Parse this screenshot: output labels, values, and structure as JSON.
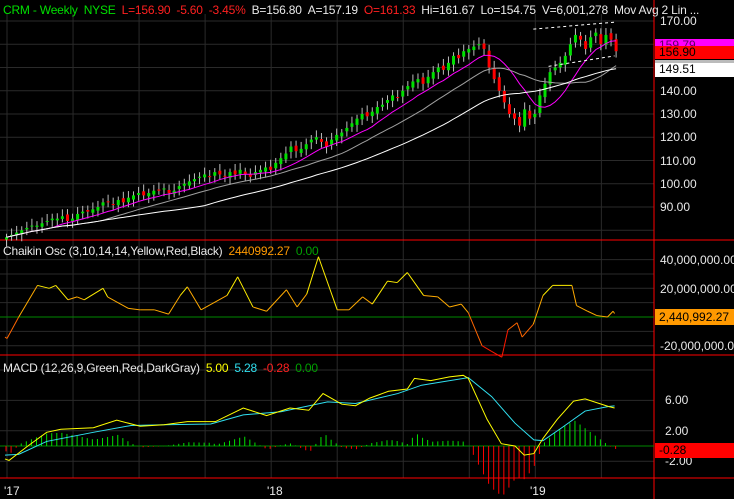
{
  "header": {
    "symbol": "CRM - Weekly",
    "exchange": "NYSE",
    "last": "L=156.90",
    "change": "-5.60",
    "change_pct": "-3.45%",
    "bid": "B=156.80",
    "ask": "A=157.19",
    "open": "O=161.33",
    "high": "Hi=161.67",
    "low": "Lo=154.75",
    "volume": "V=6,001,278",
    "study": "Mov Avg 2 Lin ..."
  },
  "price_axis": {
    "ticks": [
      "170.00",
      "140.00",
      "130.00",
      "120.00",
      "110.00",
      "100.00",
      "90.00"
    ],
    "tags": {
      "ma_short": "159.79",
      "last": "156.90",
      "ma_long": "149.51"
    }
  },
  "chaikin": {
    "title": "Chaikin Osc (3,10,14,14,Yellow,Red,Black)",
    "value": "2440992.27",
    "zero": "0.00",
    "ticks": [
      "40,000,000.00",
      "20,000,000.00",
      "-20,000,000.00"
    ],
    "tag": "2,440,992.27"
  },
  "macd": {
    "title": "MACD (12,26,9,Green,Red,DarkGray)",
    "macd_value": "5.00",
    "signal_value": "5.28",
    "hist_value": "-0.28",
    "zero": "0.00",
    "ticks": [
      "6.00",
      "2.00",
      "-2.00"
    ],
    "tag": "-0.28"
  },
  "date_axis": {
    "labels": [
      "'17",
      "'18",
      "'19"
    ]
  },
  "colors": {
    "up": "#00e000",
    "down": "#ff0000",
    "ma10": "#ff00ff",
    "ma20": "#a0a0a0",
    "ma40": "#ffffff",
    "axis": "#ff0000",
    "grid": "#2a2a2a"
  },
  "chart_data": [
    {
      "type": "candlestick",
      "title": "CRM - Weekly",
      "x_unit": "week index from Jan 2017",
      "ylim": [
        76,
        175
      ],
      "closes": [
        77,
        78,
        79,
        80,
        81,
        82,
        82,
        83,
        84,
        85,
        85,
        86,
        84,
        85,
        87,
        88,
        88,
        89,
        90,
        92,
        92,
        91,
        93,
        92,
        94,
        95,
        96,
        95,
        96,
        97,
        97,
        98,
        96,
        97,
        99,
        100,
        101,
        102,
        103,
        104,
        103,
        105,
        104,
        103,
        105,
        104,
        106,
        104,
        103,
        105,
        106,
        107,
        106,
        109,
        111,
        113,
        116,
        114,
        115,
        117,
        119,
        120,
        118,
        116,
        119,
        121,
        122,
        124,
        126,
        128,
        130,
        129,
        131,
        133,
        134,
        136,
        138,
        137,
        140,
        142,
        144,
        145,
        143,
        146,
        148,
        150,
        149,
        152,
        155,
        154,
        157,
        158,
        159,
        160,
        158,
        150,
        145,
        140,
        135,
        130,
        128,
        125,
        132,
        128,
        130,
        138,
        143,
        148,
        150,
        152,
        155,
        160,
        164,
        162,
        158,
        163,
        165,
        160,
        164,
        162,
        157
      ],
      "moving_averages": [
        {
          "period": 10,
          "color": "#ff00ff"
        },
        {
          "period": 20,
          "color": "#a0a0a0"
        },
        {
          "period": 40,
          "color": "#ffffff"
        }
      ],
      "trendlines": [
        [
          [
            104,
            166.5
          ],
          [
            120,
            169.5
          ]
        ],
        [
          [
            107,
            150.5
          ],
          [
            120,
            155
          ]
        ]
      ]
    },
    {
      "type": "line",
      "title": "Chaikin Osc",
      "unit": "millions",
      "ylim": [
        -30,
        50
      ],
      "points": [
        [
          0,
          -14
        ],
        [
          0.4,
          -15
        ],
        [
          2.7,
          0
        ],
        [
          6.4,
          22
        ],
        [
          8.7,
          20
        ],
        [
          10,
          22
        ],
        [
          12.4,
          12
        ],
        [
          14.2,
          14
        ],
        [
          15.6,
          12
        ],
        [
          19.3,
          20
        ],
        [
          20.2,
          14
        ],
        [
          24.3,
          6
        ],
        [
          26.6,
          5
        ],
        [
          29.4,
          5
        ],
        [
          32.2,
          2
        ],
        [
          34.5,
          15
        ],
        [
          35.9,
          21
        ],
        [
          38.6,
          5
        ],
        [
          43.7,
          15
        ],
        [
          45.8,
          28
        ],
        [
          48.8,
          7
        ],
        [
          51.5,
          4
        ],
        [
          55.4,
          19
        ],
        [
          57.5,
          7
        ],
        [
          59.4,
          16
        ],
        [
          61.7,
          42
        ],
        [
          65.4,
          5
        ],
        [
          67.7,
          5
        ],
        [
          70.4,
          14
        ],
        [
          72.3,
          9
        ],
        [
          75.3,
          25
        ],
        [
          77.2,
          24
        ],
        [
          79.2,
          31
        ],
        [
          82.4,
          15
        ],
        [
          85.2,
          14
        ],
        [
          87.5,
          7
        ],
        [
          89.8,
          9
        ],
        [
          91.2,
          3
        ],
        [
          93.9,
          -20
        ],
        [
          95.8,
          -24
        ],
        [
          97.8,
          -28
        ],
        [
          99,
          -9
        ],
        [
          100.8,
          -4
        ],
        [
          101.8,
          -14
        ],
        [
          104,
          -5
        ],
        [
          105.9,
          15
        ],
        [
          107.8,
          22
        ],
        [
          111.6,
          22
        ],
        [
          112.5,
          8
        ],
        [
          114.7,
          4
        ],
        [
          116.5,
          1
        ],
        [
          118.6,
          0
        ],
        [
          119.7,
          4
        ],
        [
          120,
          2.44
        ]
      ]
    },
    {
      "type": "line",
      "title": "MACD",
      "ylim": [
        -4,
        11
      ],
      "macd": [
        [
          0,
          -1.7
        ],
        [
          0.8,
          -1.9
        ],
        [
          4.5,
          0
        ],
        [
          8.2,
          1.8
        ],
        [
          11,
          2.2
        ],
        [
          17.4,
          2.4
        ],
        [
          22,
          3.4
        ],
        [
          26.6,
          2.6
        ],
        [
          31.3,
          2.8
        ],
        [
          35.9,
          3.2
        ],
        [
          41.4,
          3.2
        ],
        [
          46.9,
          5
        ],
        [
          51.5,
          4
        ],
        [
          56.1,
          5
        ],
        [
          59.8,
          4.7
        ],
        [
          62.6,
          6.9
        ],
        [
          66.3,
          5.5
        ],
        [
          69,
          5.3
        ],
        [
          71.8,
          6.3
        ],
        [
          75.5,
          7.2
        ],
        [
          79.2,
          7.5
        ],
        [
          80.6,
          8.9
        ],
        [
          83.8,
          8.6
        ],
        [
          87.5,
          9.1
        ],
        [
          90.2,
          9.3
        ],
        [
          91.2,
          8.9
        ],
        [
          94.9,
          3.5
        ],
        [
          97.7,
          0.3
        ],
        [
          100.4,
          0
        ],
        [
          102.2,
          -1.2
        ],
        [
          104.1,
          -1
        ],
        [
          105.9,
          1
        ],
        [
          108.7,
          3.5
        ],
        [
          111.9,
          5.9
        ],
        [
          114.2,
          6.2
        ],
        [
          118.8,
          5.2
        ],
        [
          120,
          5
        ]
      ],
      "signal": [
        [
          0,
          -1.2
        ],
        [
          2.7,
          -1.1
        ],
        [
          8.2,
          0.6
        ],
        [
          17.4,
          1.8
        ],
        [
          24.8,
          2.7
        ],
        [
          31.3,
          2.8
        ],
        [
          40.5,
          2.9
        ],
        [
          46.9,
          4.1
        ],
        [
          54.3,
          4.5
        ],
        [
          63.5,
          5.8
        ],
        [
          69,
          5.6
        ],
        [
          77.3,
          6.9
        ],
        [
          82,
          8
        ],
        [
          91.2,
          9
        ],
        [
          95.8,
          6.5
        ],
        [
          100.4,
          3
        ],
        [
          104.1,
          0.8
        ],
        [
          105.9,
          0.7
        ],
        [
          109.6,
          2.4
        ],
        [
          114.2,
          4.6
        ],
        [
          118.8,
          5.2
        ],
        [
          120,
          5.28
        ]
      ]
    }
  ]
}
